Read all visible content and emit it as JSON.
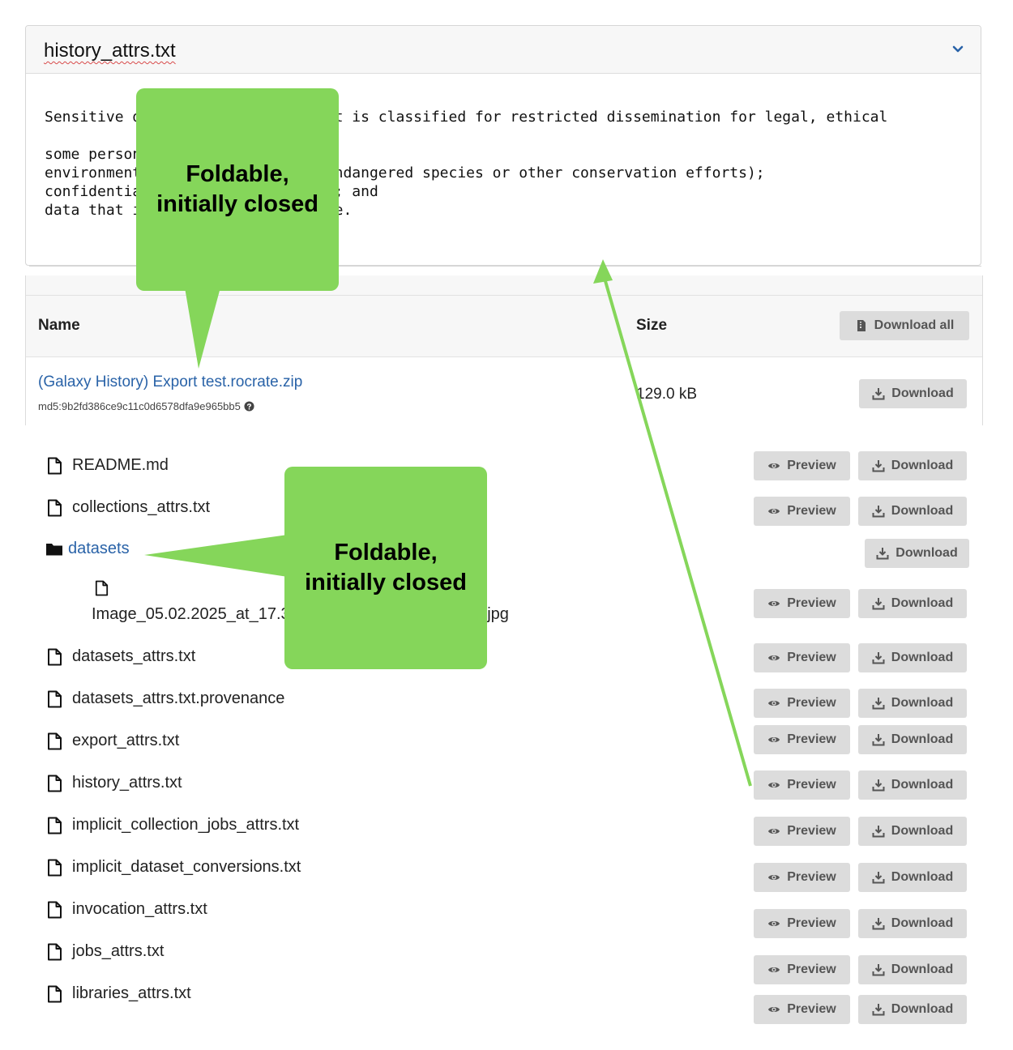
{
  "preview": {
    "title": "history_attrs.txt",
    "lines": [
      "Sensitive data is information that is classified for restricted dissemination for legal, ethical",
      "",
      "some personal information;",
      "environmental data (location of endangered species or other conservation efforts);",
      "confidential data (trade secrets); and",
      "data that is categorised sensitive."
    ]
  },
  "table": {
    "col_name": "Name",
    "col_size": "Size",
    "download_all_label": "Download all",
    "row": {
      "link": "(Galaxy History) Export test.rocrate.zip",
      "md5": "md5:9b2fd386ce9c11c0d6578dfa9e965bb5",
      "size": "129.0 kB",
      "download_label": "Download"
    }
  },
  "files": [
    {
      "name": "README.md"
    },
    {
      "name": "collections_attrs.txt"
    },
    {
      "name": "datasets",
      "folder": true
    },
    {
      "name": "Image_05.02.2025_at_17.38_1a6b0f43e0ea4d6e9b5c.jpg"
    },
    {
      "name": "datasets_attrs.txt"
    },
    {
      "name": "datasets_attrs.txt.provenance"
    },
    {
      "name": "export_attrs.txt"
    },
    {
      "name": "history_attrs.txt"
    },
    {
      "name": "implicit_collection_jobs_attrs.txt"
    },
    {
      "name": "implicit_dataset_conversions.txt"
    },
    {
      "name": "invocation_attrs.txt"
    },
    {
      "name": "jobs_attrs.txt"
    },
    {
      "name": "libraries_attrs.txt"
    }
  ],
  "buttons": {
    "preview": "Preview",
    "download": "Download"
  },
  "annotations": {
    "callout_top_line1": "Foldable,",
    "callout_top_line2": "initially closed",
    "callout_mid_line1": "Foldable,",
    "callout_mid_line2": "initially closed"
  },
  "colors": {
    "link": "#2a63a8",
    "callout": "#85d65a",
    "button_bg": "#dcdcdc"
  }
}
